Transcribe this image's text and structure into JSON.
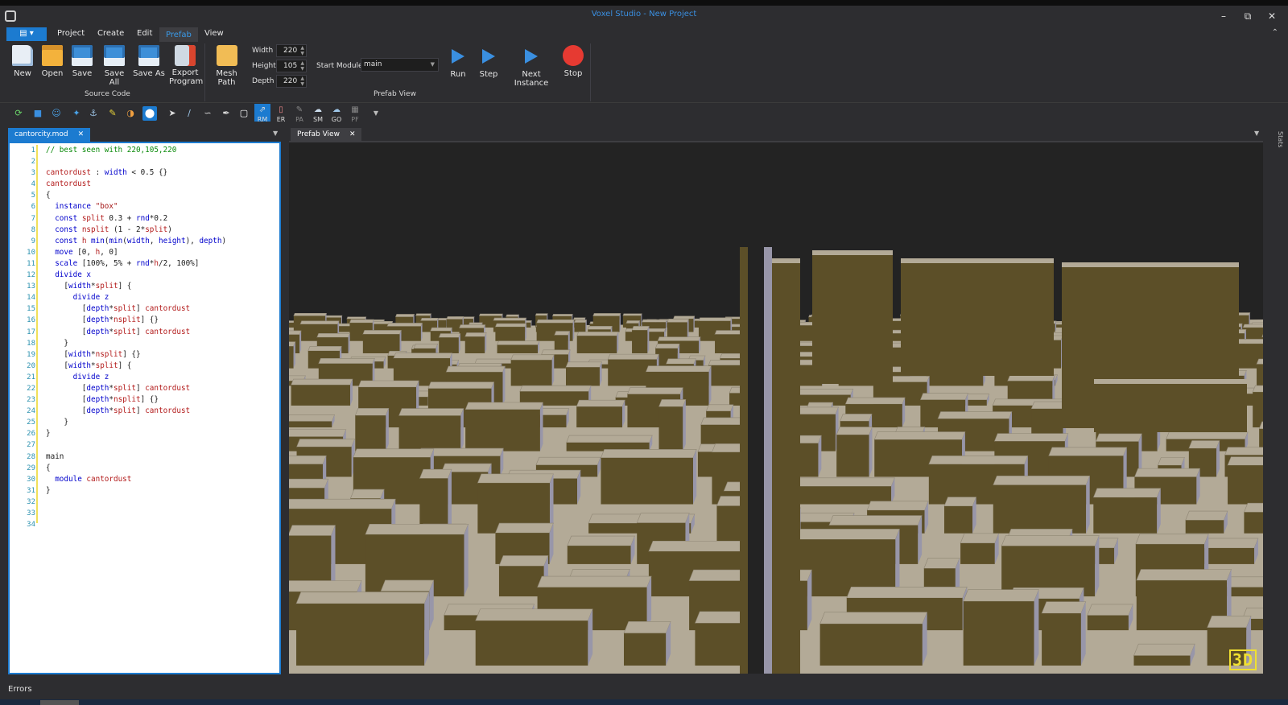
{
  "window": {
    "title": "Voxel Studio - New Project"
  },
  "menu": {
    "tabs": [
      "Project",
      "Create",
      "Edit",
      "Prefab",
      "View"
    ],
    "active": "Prefab"
  },
  "ribbon": {
    "buttons": {
      "new": "New",
      "open": "Open",
      "save": "Save",
      "save_all": "Save All",
      "save_as": "Save As",
      "export_line1": "Export",
      "export_line2": "Program",
      "mesh_path": "Mesh Path",
      "run": "Run",
      "step": "Step",
      "next_instance": "Next Instance",
      "stop": "Stop"
    },
    "groups": {
      "source_code": "Source Code",
      "prefab_view": "Prefab View"
    },
    "fields": {
      "width_label": "Width",
      "width_value": "220",
      "height_label": "Height",
      "height_value": "105",
      "depth_label": "Depth",
      "depth_value": "220",
      "start_module_label": "Start Module",
      "start_module_value": "main"
    }
  },
  "toolbar": {
    "labels": [
      "RM",
      "ER",
      "PA",
      "SM",
      "GO",
      "PF"
    ]
  },
  "tabs": {
    "editor": "cantorcity.mod",
    "viewport": "Prefab View"
  },
  "editor": {
    "lines": [
      "// best seen with 220,105,220",
      "",
      "cantordust : width < 0.5 {}",
      "cantordust",
      "{",
      "  instance \"box\"",
      "  const split 0.3 + rnd*0.2",
      "  const nsplit (1 - 2*split)",
      "  const h min(min(width, height), depth)",
      "  move [0, h, 0]",
      "  scale [100%, 5% + rnd*h/2, 100%]",
      "  divide x",
      "    [width*split] {",
      "      divide z",
      "        [depth*split] cantordust",
      "        [depth*nsplit] {}",
      "        [depth*split] cantordust",
      "    }",
      "    [width*nsplit] {}",
      "    [width*split] {",
      "      divide z",
      "        [depth*split] cantordust",
      "        [depth*nsplit] {}",
      "        [depth*split] cantordust",
      "    }",
      "}",
      "",
      "main",
      "{",
      "  module cantordust",
      "}",
      "",
      "",
      ""
    ]
  },
  "viewport": {
    "badge": "3D"
  },
  "side": {
    "stats": "Stats"
  },
  "status": {
    "errors": "Errors"
  },
  "colors": {
    "accent": "#1c7bd0",
    "top_face": "#b3aa97",
    "front_face": "#5c4f28",
    "side_face": "#9896a9",
    "badge": "#f0e030"
  }
}
